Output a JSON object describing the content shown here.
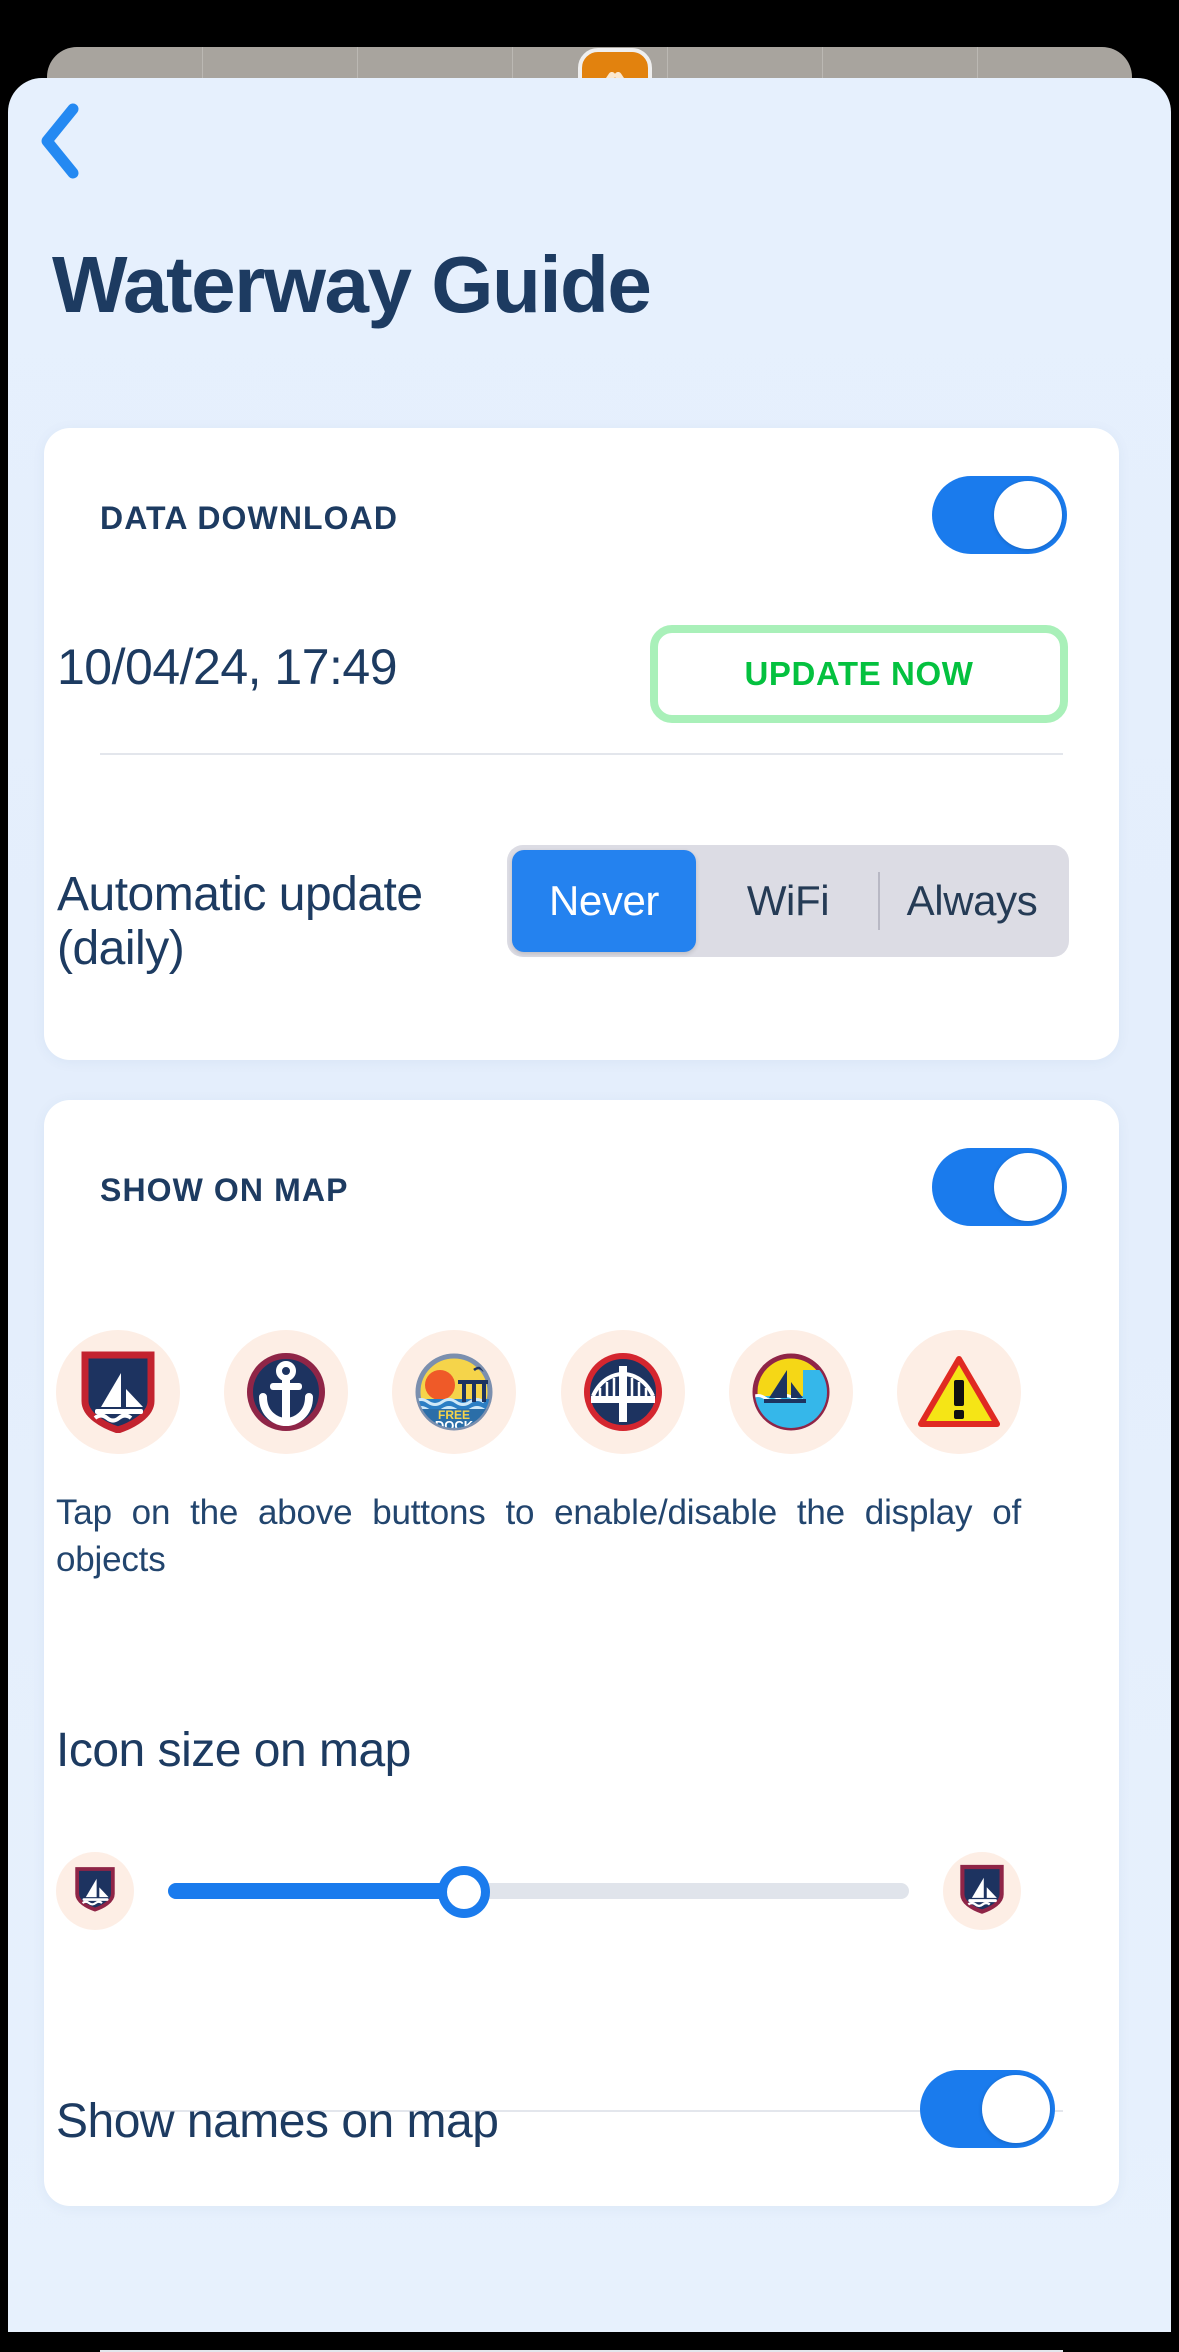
{
  "background": {
    "app_icon": "orange-app-icon"
  },
  "header": {
    "back_icon": "chevron-left-icon",
    "title": "Waterway Guide"
  },
  "data_download": {
    "section_title": "DATA DOWNLOAD",
    "enabled": true,
    "last_update": "10/04/24, 17:49",
    "update_button": "UPDATE NOW",
    "auto_update_label": "Automatic update (daily)",
    "auto_update_options": [
      "Never",
      "WiFi",
      "Always"
    ],
    "auto_update_selected": "Never"
  },
  "show_on_map": {
    "section_title": "SHOW ON MAP",
    "enabled": true,
    "object_icons": [
      {
        "name": "marina-shield-icon",
        "label": "Marina"
      },
      {
        "name": "anchor-badge-icon",
        "label": "Anchor"
      },
      {
        "name": "free-dock-icon",
        "label": "Free Dock"
      },
      {
        "name": "bridge-icon",
        "label": "Bridge"
      },
      {
        "name": "anchorage-icon",
        "label": "Anchorage"
      },
      {
        "name": "hazard-warning-icon",
        "label": "Hazard"
      }
    ],
    "tap_hint": "Tap on the above buttons to enable/disable the display of objects",
    "icon_size_label": "Icon size on map",
    "icon_size_value": 40,
    "icon_size_min_icon": "marina-shield-small-icon",
    "icon_size_max_icon": "marina-shield-large-icon",
    "show_names_label": "Show names on map",
    "show_names_enabled": true
  },
  "colors": {
    "accent_blue": "#1a7bed",
    "navy": "#1d3b61",
    "green": "#04c13f",
    "green_border": "#a9f0b9",
    "sheet_bg": "#e6f0fd",
    "icon_chip_bg": "#fdeee5",
    "segment_track": "#dcdce4"
  }
}
